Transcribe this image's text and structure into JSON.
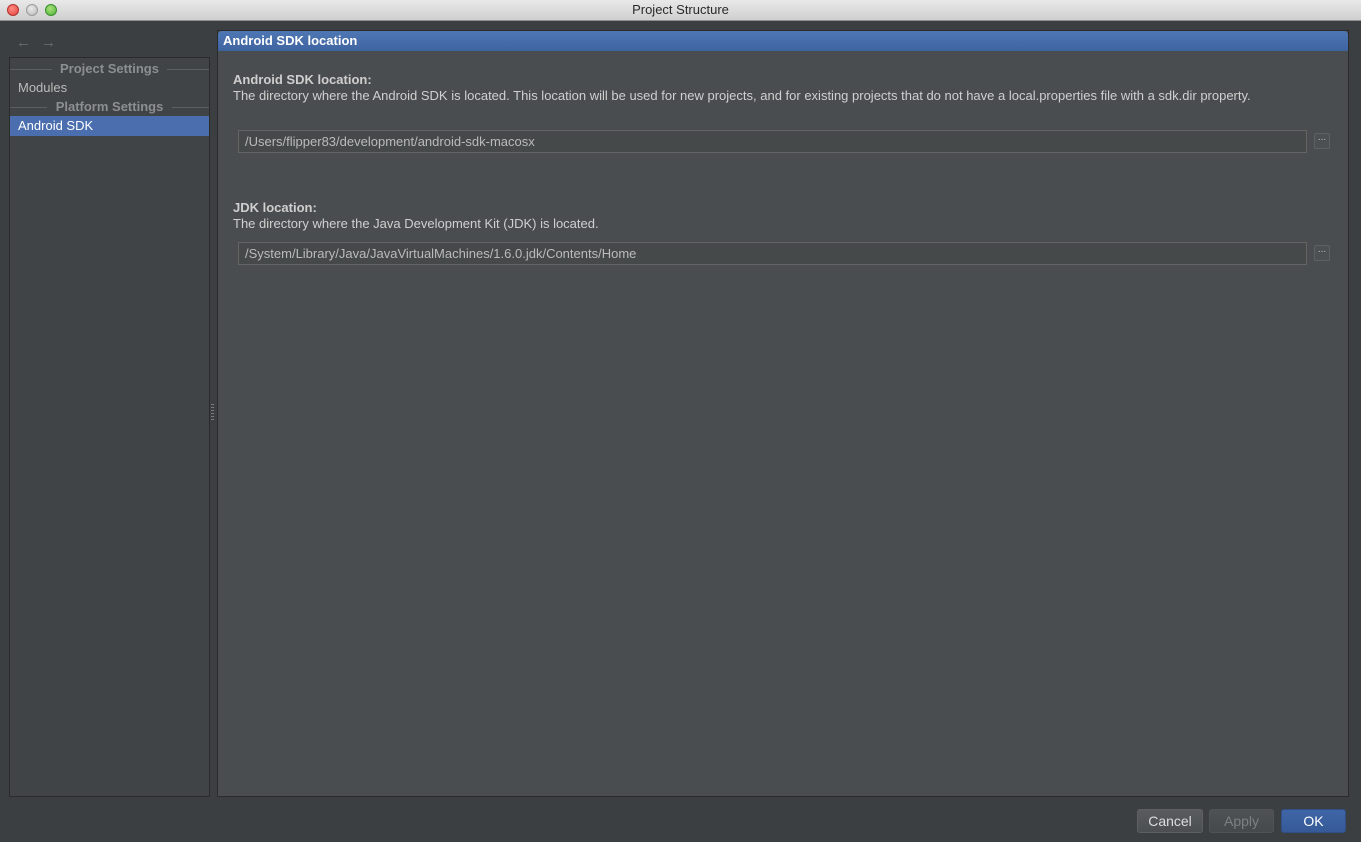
{
  "window": {
    "title": "Project Structure"
  },
  "nav": {
    "back_icon": "←",
    "forward_icon": "→"
  },
  "sidebar": {
    "sections": [
      {
        "header": "Project Settings",
        "items": [
          "Modules"
        ]
      },
      {
        "header": "Platform Settings",
        "items": [
          "Android SDK"
        ]
      }
    ],
    "selected": "Android SDK"
  },
  "main": {
    "header": "Android SDK location",
    "sdk": {
      "label": "Android SDK location:",
      "description": "The directory where the Android SDK is located. This location will be used for new projects, and for existing projects that do not have a local.properties file with a sdk.dir property.",
      "path": "/Users/flipper83/development/android-sdk-macosx",
      "browse_label": "..."
    },
    "jdk": {
      "label": "JDK location:",
      "description": "The directory where the Java Development Kit (JDK) is located.",
      "path": "/System/Library/Java/JavaVirtualMachines/1.6.0.jdk/Contents/Home",
      "browse_label": "..."
    }
  },
  "buttons": {
    "cancel": "Cancel",
    "apply": "Apply",
    "ok": "OK"
  },
  "colors": {
    "accent": "#4b6eaf",
    "background": "#3c3f41",
    "panel": "#4a4d50"
  }
}
